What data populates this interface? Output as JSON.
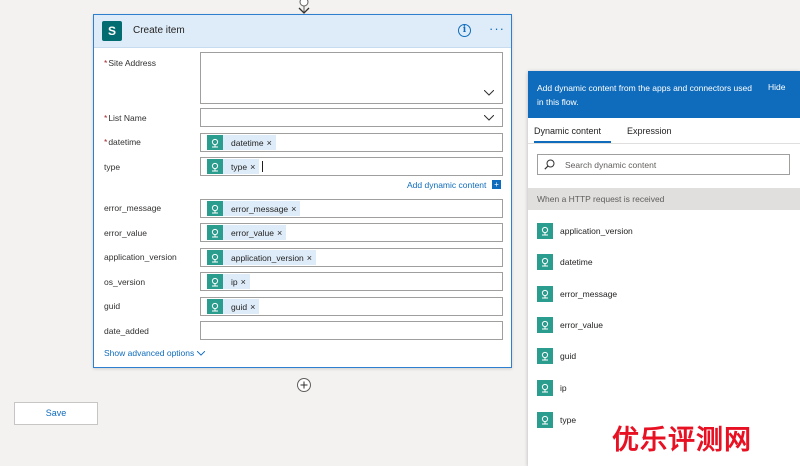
{
  "card": {
    "title": "Create item",
    "fields": [
      {
        "label": "Site Address",
        "required": true,
        "type": "dropdown-tall",
        "value": ""
      },
      {
        "label": "List Name",
        "required": true,
        "type": "dropdown",
        "value": ""
      },
      {
        "label": "datetime",
        "required": true,
        "type": "token",
        "token": "datetime"
      },
      {
        "label": "type",
        "required": false,
        "type": "token",
        "token": "type",
        "focused": true
      },
      {
        "label": "error_message",
        "required": false,
        "type": "token",
        "token": "error_message"
      },
      {
        "label": "error_value",
        "required": false,
        "type": "token",
        "token": "error_value"
      },
      {
        "label": "application_version",
        "required": false,
        "type": "token",
        "token": "application_version"
      },
      {
        "label": "os_version",
        "required": false,
        "type": "token",
        "token": "ip"
      },
      {
        "label": "guid",
        "required": false,
        "type": "token",
        "token": "guid"
      },
      {
        "label": "date_added",
        "required": false,
        "type": "empty",
        "value": ""
      }
    ],
    "required_mark": "*",
    "token_remove": "×",
    "add_dynamic_content": "Add dynamic content",
    "show_advanced_options": "Show advanced options"
  },
  "save_label": "Save",
  "panel": {
    "header_text": "Add dynamic content from the apps and connectors used in this flow.",
    "hide_label": "Hide",
    "tabs": [
      {
        "label": "Dynamic content",
        "active": true
      },
      {
        "label": "Expression",
        "active": false
      }
    ],
    "search_placeholder": "Search dynamic content",
    "section_title": "When a HTTP request is received",
    "items": [
      "application_version",
      "datetime",
      "error_message",
      "error_value",
      "guid",
      "ip",
      "type"
    ]
  },
  "watermark": "优乐评测网",
  "colors": {
    "accent": "#0f6cbd",
    "token_icon": "#2a9d8f",
    "token_bg": "#deecf9",
    "required": "#a4262c",
    "sharepoint": "#036c70"
  },
  "icons": {
    "connector": "down-arrow-icon",
    "add_step": "plus-circle-icon",
    "token": "request-icon",
    "search": "search-icon"
  }
}
